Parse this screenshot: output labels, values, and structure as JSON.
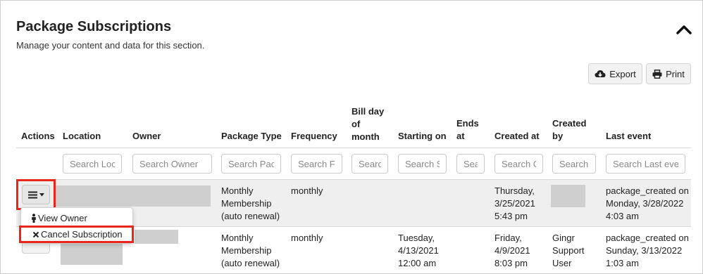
{
  "section": {
    "title": "Package Subscriptions",
    "subtitle": "Manage your content and data for this section."
  },
  "toolbar": {
    "export_label": "Export",
    "print_label": "Print"
  },
  "table": {
    "headers": {
      "actions": "Actions",
      "location": "Location",
      "owner": "Owner",
      "package_type": "Package Type",
      "frequency": "Frequency",
      "bill_day": [
        "Bill day",
        "of",
        "month"
      ],
      "starting_on": "Starting on",
      "ends_at": [
        "Ends",
        "at"
      ],
      "created_at": "Created at",
      "created_by": [
        "Created",
        "by"
      ],
      "last_event": "Last event"
    },
    "search_placeholders": {
      "location": "Search Loc",
      "owner": "Search Owner",
      "package_type": "Search Pac",
      "frequency": "Search Fi",
      "bill_day": "Searc",
      "starting_on": "Search S",
      "ends_at": "Sea",
      "created_at": "Search C",
      "created_by": "Search",
      "last_event": "Search Last ever"
    },
    "rows": [
      {
        "package_type": [
          "Monthly",
          "Membership",
          "(auto renewal)"
        ],
        "frequency": "monthly",
        "starting_on": [],
        "created_at": [
          "Thursday,",
          "3/25/2021",
          "5:43 pm"
        ],
        "created_by": [],
        "last_event": [
          "package_created on",
          "Monday, 3/28/2022",
          "4:03 am"
        ]
      },
      {
        "package_type": [
          "Monthly",
          "Membership",
          "(auto renewal)"
        ],
        "frequency": "monthly",
        "starting_on": [
          "Tuesday,",
          "4/13/2021",
          "12:00 am"
        ],
        "created_at": [
          "Friday,",
          "4/9/2021",
          "8:03 pm"
        ],
        "created_by": [
          "Gingr",
          "Support",
          "User"
        ],
        "last_event": [
          "package_created on",
          "Sunday, 3/13/2022",
          "1:03 am"
        ]
      }
    ]
  },
  "actions_menu": {
    "items": [
      {
        "label": "View Owner",
        "icon": "person-icon"
      },
      {
        "label": "Cancel Subscription",
        "icon": "close-icon"
      }
    ]
  },
  "colors": {
    "highlight": "#e8271c",
    "row_alt": "#efefef"
  }
}
